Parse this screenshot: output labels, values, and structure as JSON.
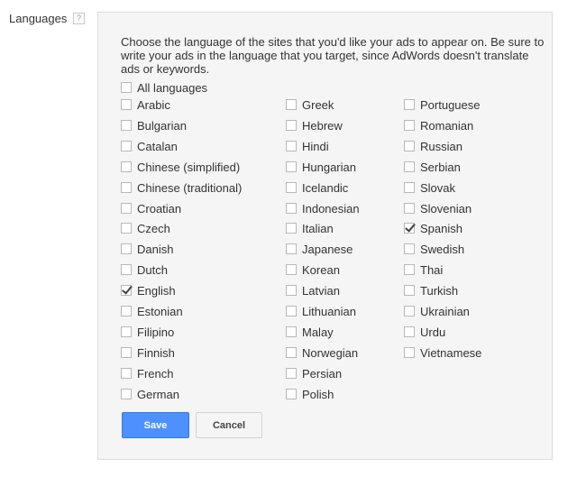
{
  "field": {
    "label": "Languages",
    "help_icon": "?"
  },
  "panel": {
    "description": "Choose the language of the sites that you'd like your ads to appear on. Be sure to write your ads in the language that you target, since AdWords doesn't translate ads or keywords.",
    "all_languages": {
      "label": "All languages",
      "checked": false
    },
    "columns": [
      [
        {
          "label": "Arabic",
          "checked": false
        },
        {
          "label": "Bulgarian",
          "checked": false
        },
        {
          "label": "Catalan",
          "checked": false
        },
        {
          "label": "Chinese (simplified)",
          "checked": false
        },
        {
          "label": "Chinese (traditional)",
          "checked": false
        },
        {
          "label": "Croatian",
          "checked": false
        },
        {
          "label": "Czech",
          "checked": false
        },
        {
          "label": "Danish",
          "checked": false
        },
        {
          "label": "Dutch",
          "checked": false
        },
        {
          "label": "English",
          "checked": true
        },
        {
          "label": "Estonian",
          "checked": false
        },
        {
          "label": "Filipino",
          "checked": false
        },
        {
          "label": "Finnish",
          "checked": false
        },
        {
          "label": "French",
          "checked": false
        },
        {
          "label": "German",
          "checked": false
        }
      ],
      [
        {
          "label": "Greek",
          "checked": false
        },
        {
          "label": "Hebrew",
          "checked": false
        },
        {
          "label": "Hindi",
          "checked": false
        },
        {
          "label": "Hungarian",
          "checked": false
        },
        {
          "label": "Icelandic",
          "checked": false
        },
        {
          "label": "Indonesian",
          "checked": false
        },
        {
          "label": "Italian",
          "checked": false
        },
        {
          "label": "Japanese",
          "checked": false
        },
        {
          "label": "Korean",
          "checked": false
        },
        {
          "label": "Latvian",
          "checked": false
        },
        {
          "label": "Lithuanian",
          "checked": false
        },
        {
          "label": "Malay",
          "checked": false
        },
        {
          "label": "Norwegian",
          "checked": false
        },
        {
          "label": "Persian",
          "checked": false
        },
        {
          "label": "Polish",
          "checked": false
        }
      ],
      [
        {
          "label": "Portuguese",
          "checked": false
        },
        {
          "label": "Romanian",
          "checked": false
        },
        {
          "label": "Russian",
          "checked": false
        },
        {
          "label": "Serbian",
          "checked": false
        },
        {
          "label": "Slovak",
          "checked": false
        },
        {
          "label": "Slovenian",
          "checked": false
        },
        {
          "label": "Spanish",
          "checked": true
        },
        {
          "label": "Swedish",
          "checked": false
        },
        {
          "label": "Thai",
          "checked": false
        },
        {
          "label": "Turkish",
          "checked": false
        },
        {
          "label": "Ukrainian",
          "checked": false
        },
        {
          "label": "Urdu",
          "checked": false
        },
        {
          "label": "Vietnamese",
          "checked": false
        }
      ]
    ],
    "save_label": "Save",
    "cancel_label": "Cancel"
  },
  "colors": {
    "save_button": "#4d90fe",
    "panel_background": "#f5f5f5"
  }
}
